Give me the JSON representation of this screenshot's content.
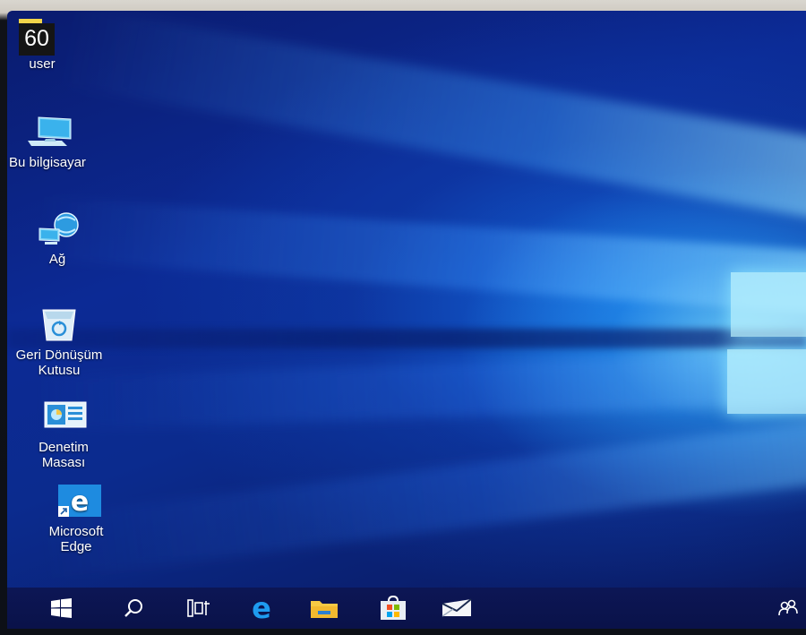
{
  "clock_badge": {
    "number": "60",
    "caption": "user"
  },
  "desktop_icons": [
    {
      "label": "Bu bilgisayar",
      "icon": "this-pc-icon"
    },
    {
      "label": "Ağ",
      "icon": "network-icon"
    },
    {
      "label": "Geri Dönüşüm Kutusu",
      "line1": "Geri Dönüşüm",
      "line2": "Kutusu",
      "icon": "recycle-bin-icon"
    },
    {
      "label": "Denetim Masası",
      "line1": "Denetim",
      "line2": "Masası",
      "icon": "control-panel-icon"
    },
    {
      "label": "Microsoft Edge",
      "line1": "Microsoft",
      "line2": "Edge",
      "icon": "edge-icon"
    }
  ],
  "taskbar": {
    "buttons": [
      "start-icon",
      "search-icon",
      "task-view-icon",
      "edge-icon",
      "file-explorer-icon",
      "store-icon",
      "mail-icon"
    ],
    "tray": [
      "people-icon"
    ]
  },
  "colors": {
    "accent": "#2b8be8",
    "taskbar": "#0c1655",
    "badge_bar": "#f2d54a"
  }
}
